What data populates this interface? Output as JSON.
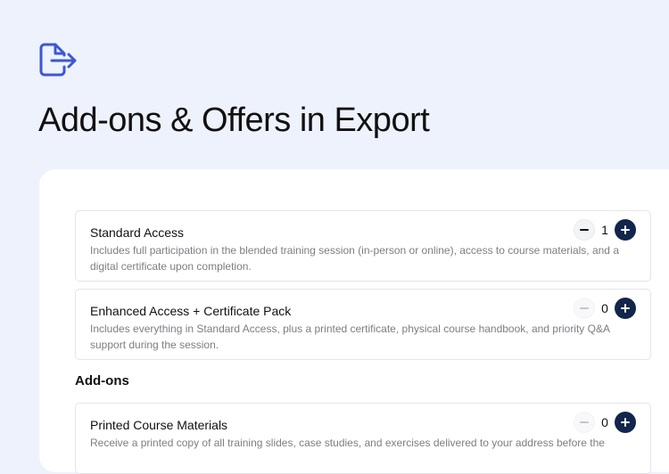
{
  "page": {
    "title": "Add-ons & Offers in Export",
    "icon": "file-export-icon"
  },
  "tickets": [
    {
      "name": "Standard Access",
      "description": "Includes full participation in the blended training session (in-person or online), access to course materials, and a digital certificate upon completion.",
      "quantity": "1"
    },
    {
      "name": "Enhanced Access + Certificate Pack",
      "description": "Includes everything in Standard Access, plus a printed certificate, physical course handbook, and priority Q&A support during the session.",
      "quantity": "0"
    }
  ],
  "addons": {
    "heading": "Add-ons",
    "items": [
      {
        "name": "Printed Course Materials",
        "description": "Receive a printed copy of all training slides, case studies, and exercises delivered to your address before the",
        "quantity": "0"
      }
    ]
  },
  "colors": {
    "background": "#eef2fd",
    "accent_icon": "#3b57d6",
    "plus_button": "#12254a"
  }
}
